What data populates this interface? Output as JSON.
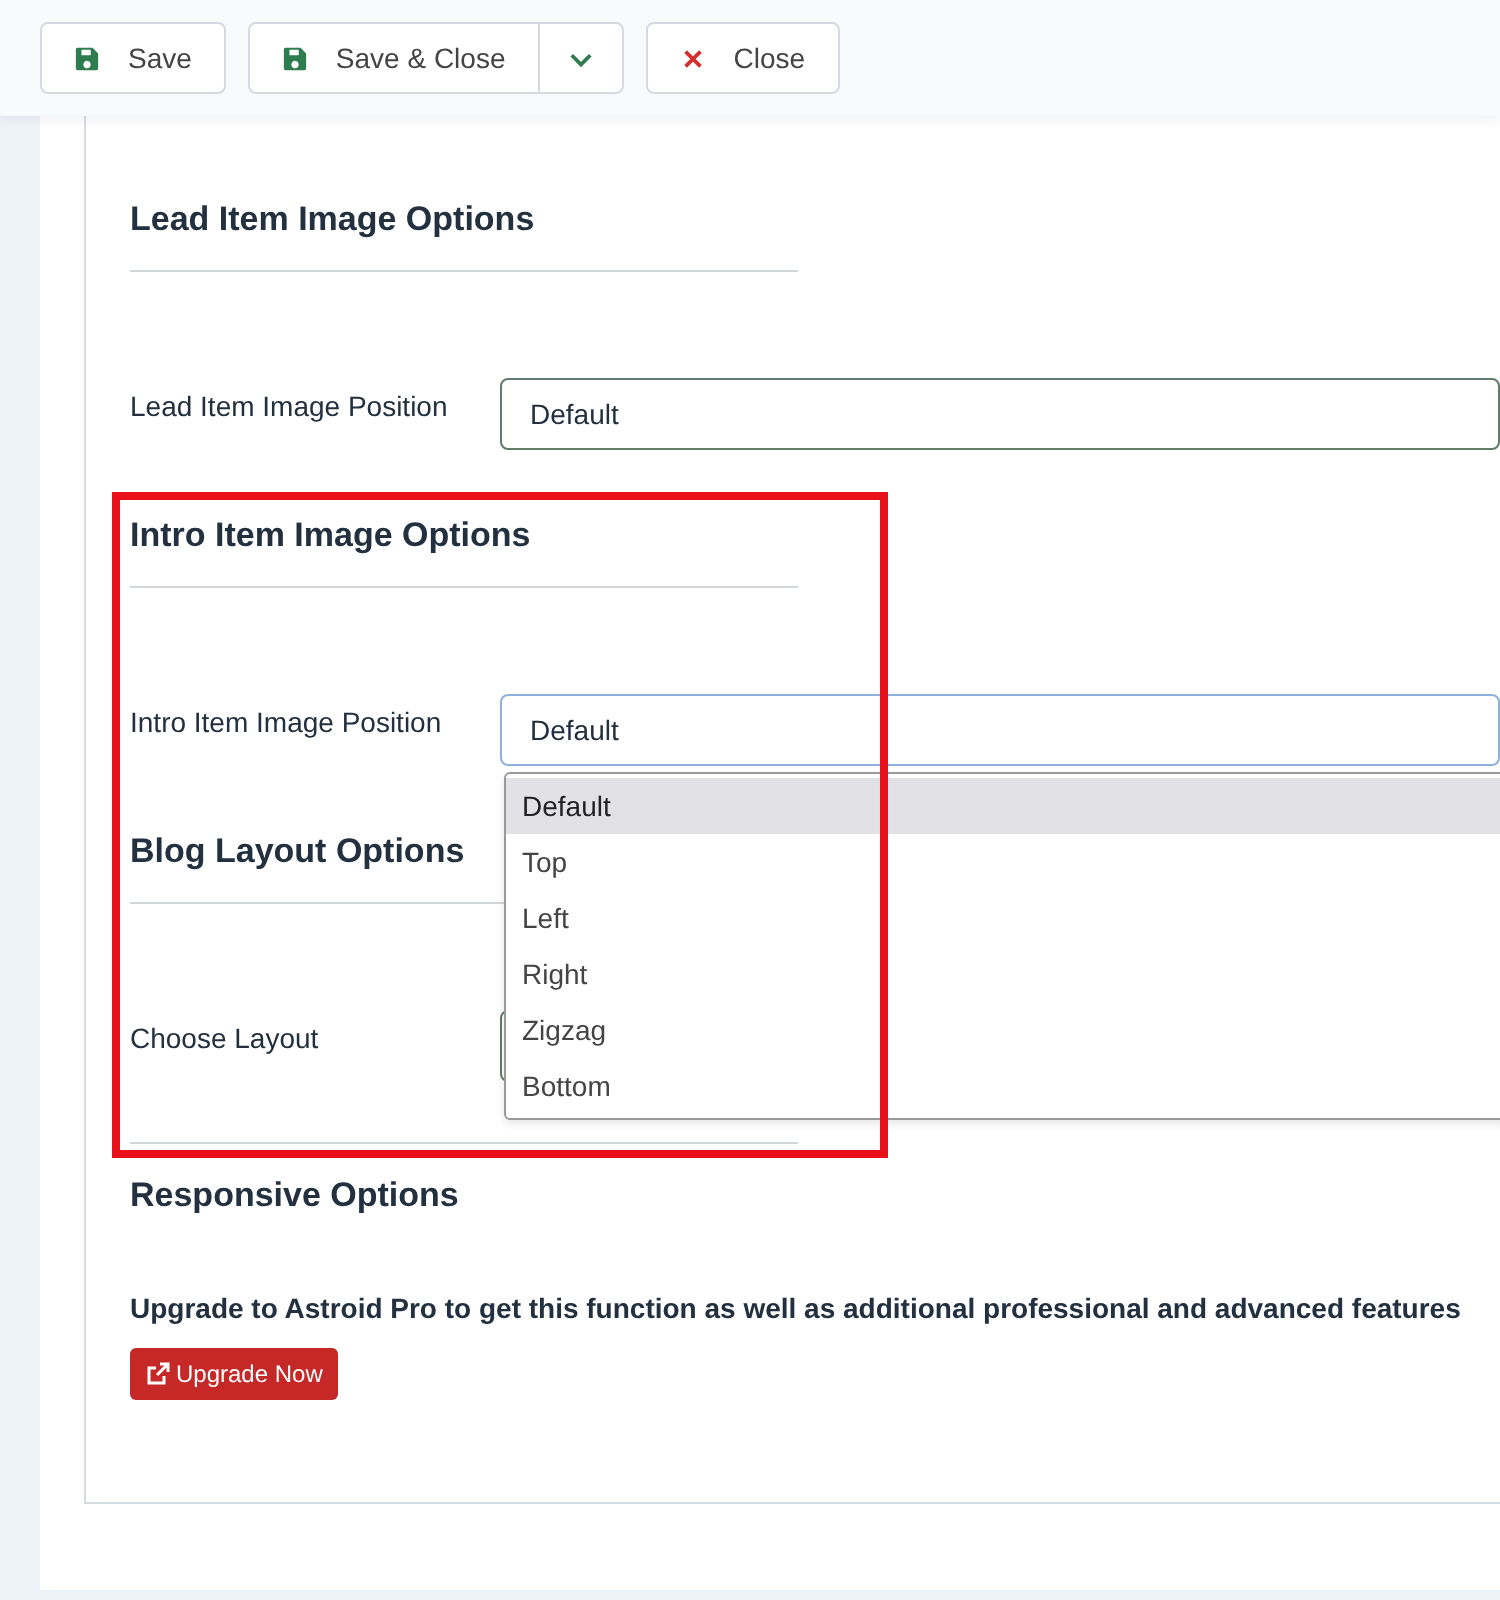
{
  "toolbar": [
    {
      "kind": "save",
      "label": "Save"
    },
    {
      "kind": "split",
      "label": "Save & Close"
    },
    {
      "kind": "close",
      "label": "Close"
    }
  ],
  "sections": [
    {
      "heading": "Lead Item Image Options",
      "field": {
        "label": "Lead Item Image Position",
        "value": "Default",
        "focused": false
      }
    },
    {
      "heading": "Intro Item Image Options",
      "field": {
        "label": "Intro Item Image Position",
        "value": "Default",
        "focused": true,
        "open": true
      }
    },
    {
      "heading": "Blog Layout Options",
      "field": {
        "label": "Choose Layout",
        "focused": false
      }
    }
  ],
  "dropdown": [
    {
      "label": "Default",
      "selected": true
    },
    {
      "label": "Top",
      "selected": false
    },
    {
      "label": "Left",
      "selected": false
    },
    {
      "label": "Right",
      "selected": false
    },
    {
      "label": "Zigzag",
      "selected": false
    },
    {
      "label": "Bottom",
      "selected": false
    }
  ],
  "responsive": {
    "heading": "Responsive Options",
    "message": "Upgrade to Astroid Pro to get this function as well as additional professional and advanced features",
    "button": "Upgrade Now"
  }
}
